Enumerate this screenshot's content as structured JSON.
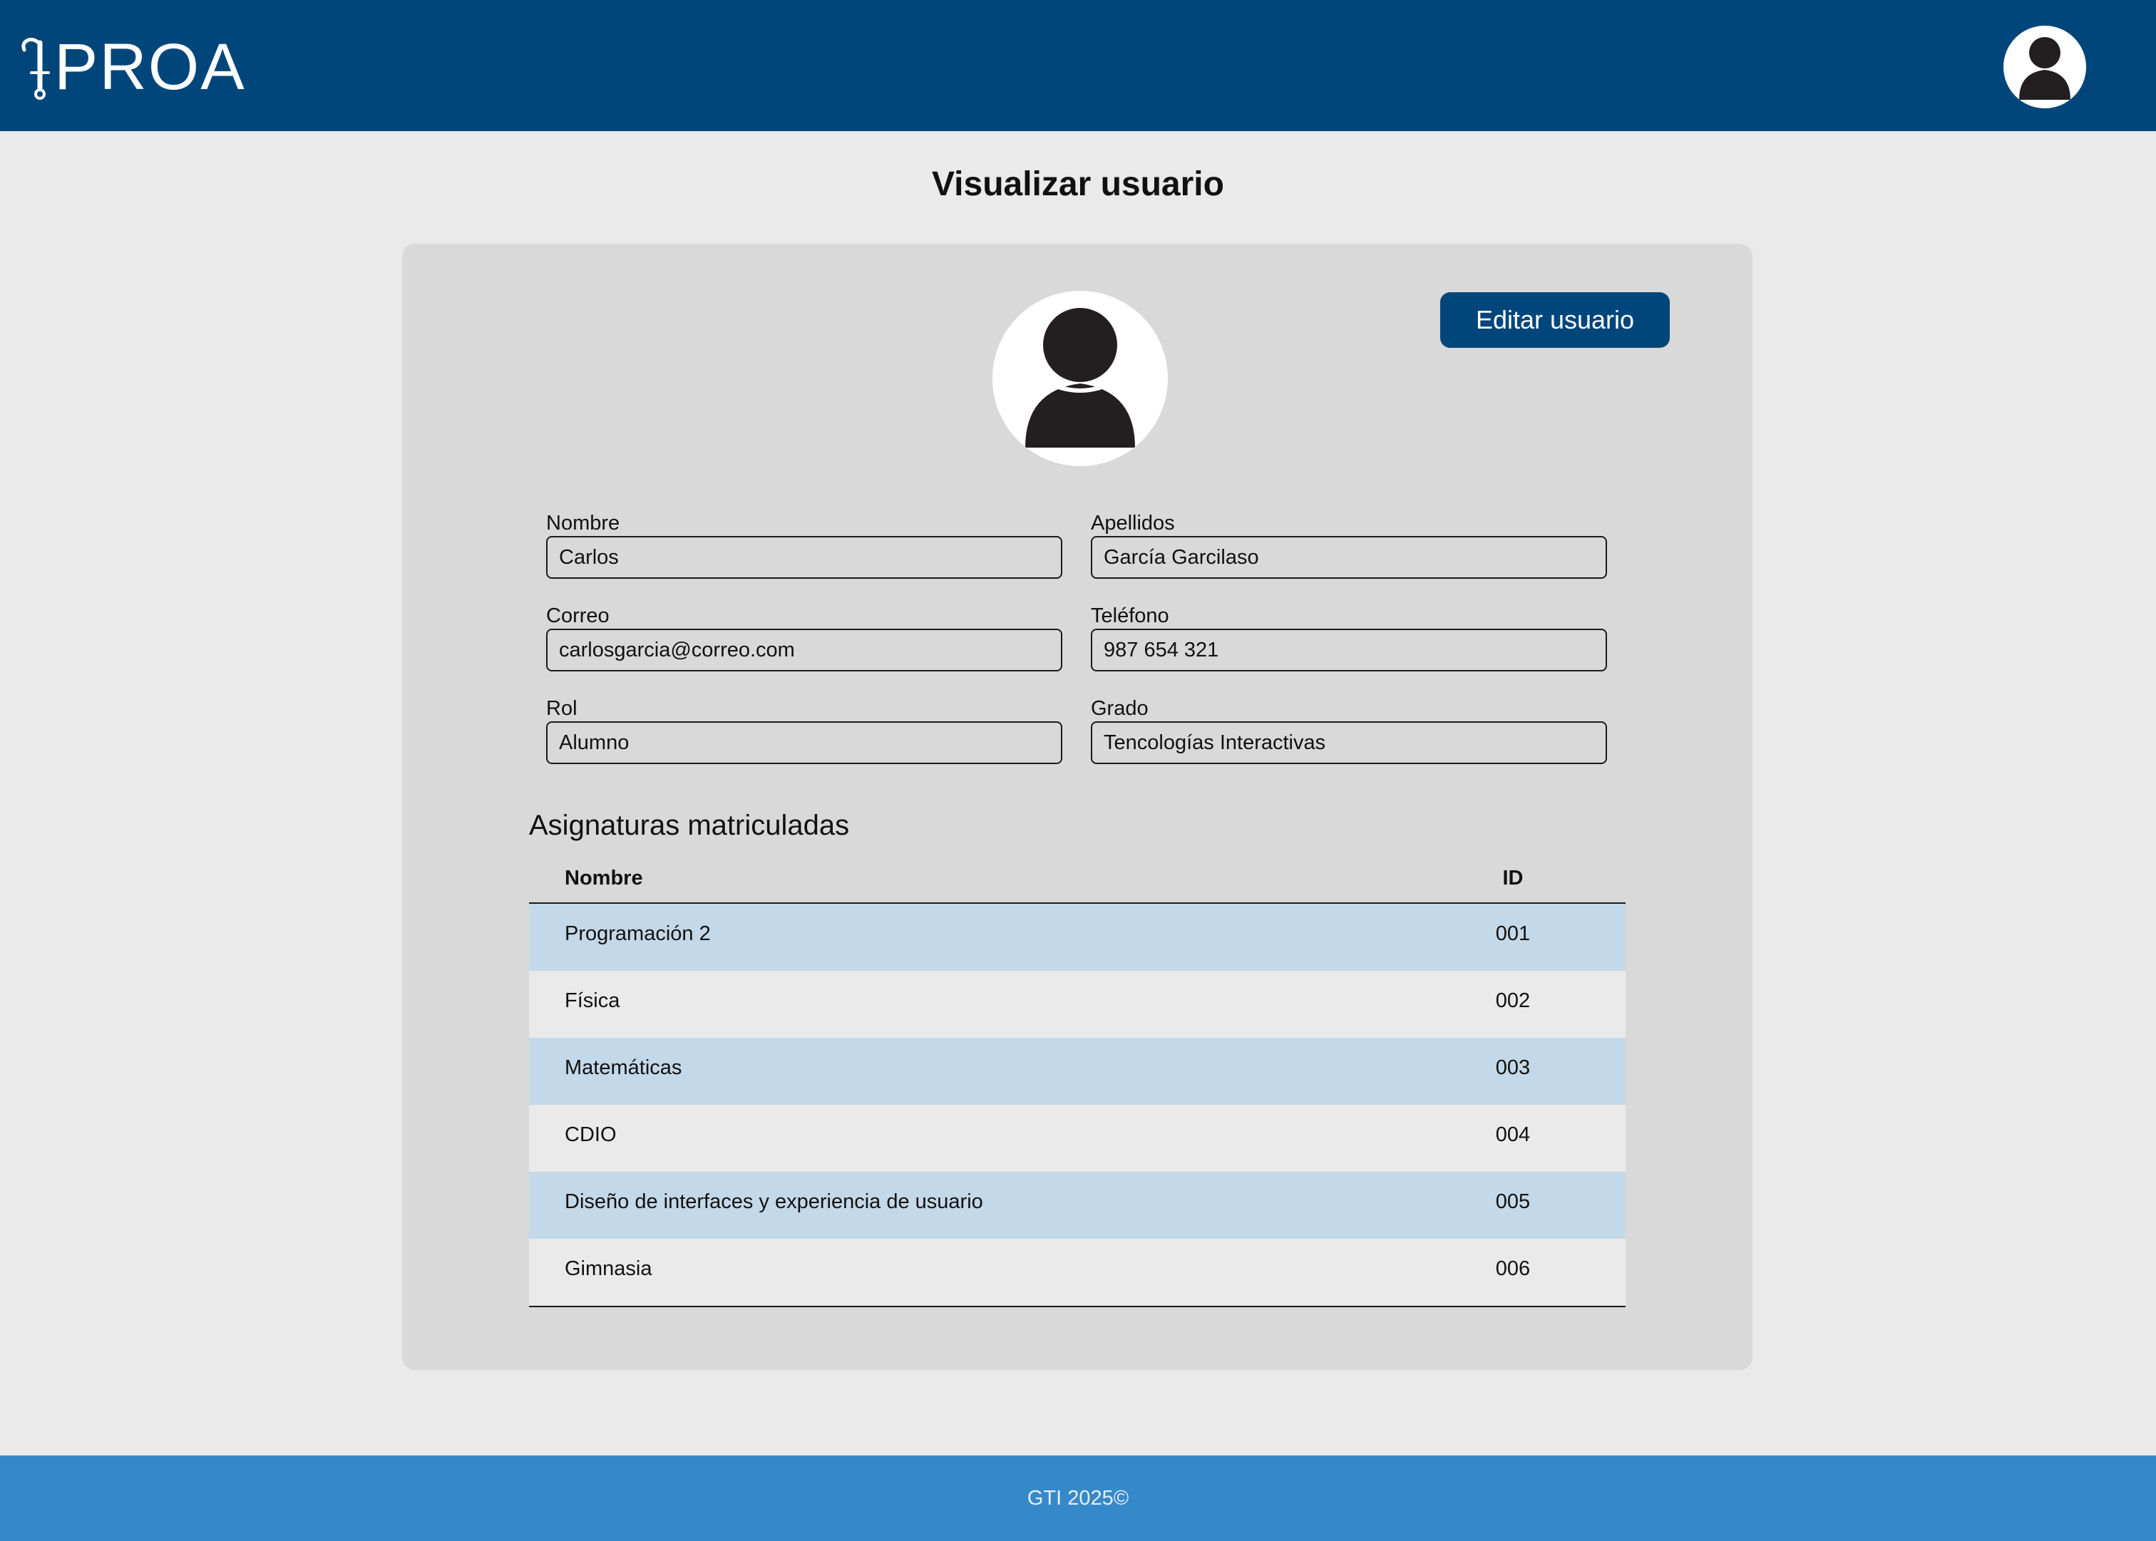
{
  "header": {
    "logo_text": "PROA",
    "user_avatar_icon": "user-avatar-icon"
  },
  "page": {
    "title": "Visualizar usuario"
  },
  "profile": {
    "avatar_icon": "user-avatar-icon",
    "edit_button_label": "Editar usuario"
  },
  "fields": {
    "nombre": {
      "label": "Nombre",
      "value": "Carlos"
    },
    "apellidos": {
      "label": "Apellidos",
      "value": "García Garcilaso"
    },
    "correo": {
      "label": "Correo",
      "value": "carlosgarcia@correo.com"
    },
    "telefono": {
      "label": "Teléfono",
      "value": "987 654 321"
    },
    "rol": {
      "label": "Rol",
      "value": "Alumno"
    },
    "grado": {
      "label": "Grado",
      "value": "Tencologías Interactivas"
    }
  },
  "subjects": {
    "title": "Asignaturas matriculadas",
    "columns": {
      "name": "Nombre",
      "id": "ID"
    },
    "rows": [
      {
        "name": "Programación 2",
        "id": "001"
      },
      {
        "name": "Física",
        "id": "002"
      },
      {
        "name": "Matemáticas",
        "id": "003"
      },
      {
        "name": "CDIO",
        "id": "004"
      },
      {
        "name": "Diseño de interfaces y experiencia de usuario",
        "id": "005"
      },
      {
        "name": "Gimnasia",
        "id": "006"
      }
    ]
  },
  "footer": {
    "text": "GTI 2025©"
  },
  "colors": {
    "header_bg": "#01467a",
    "footer_bg": "#3689c9",
    "card_bg": "#d9d9d9",
    "row_highlight": "#c3d8e8",
    "page_bg": "#eaeaea"
  }
}
